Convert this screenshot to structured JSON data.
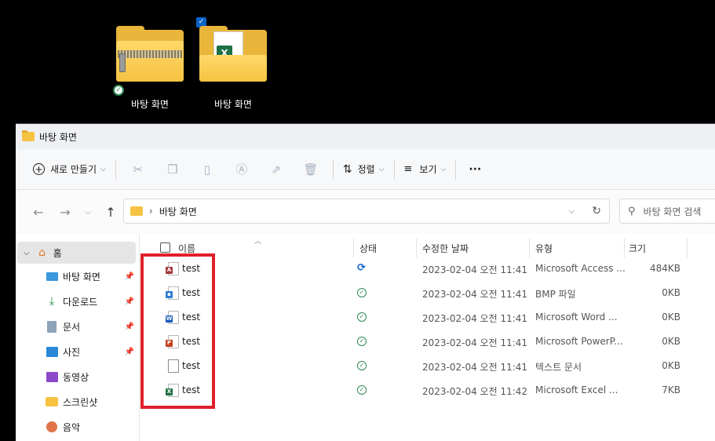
{
  "desktop": {
    "icons": [
      {
        "label": "바탕 화면",
        "type": "zip-folder",
        "status": "synced"
      },
      {
        "label": "바탕 화면",
        "type": "excel-folder",
        "selected": true
      }
    ]
  },
  "window": {
    "title": "바탕 화면",
    "toolbar": {
      "new_label": "새로 만들기",
      "sort_label": "정렬",
      "view_label": "보기",
      "more_label": "···",
      "icons": [
        "cut-icon",
        "copy-icon",
        "paste-icon",
        "rename-icon",
        "share-icon",
        "delete-icon"
      ]
    },
    "address": {
      "path_sep": "›",
      "path": "바탕 화면",
      "search_placeholder": "바탕 화면 검색"
    },
    "sidebar": {
      "home_label": "홈",
      "items": [
        {
          "label": "바탕 화면",
          "icon": "desktop-icon",
          "pinned": true
        },
        {
          "label": "다운로드",
          "icon": "download-icon",
          "pinned": true
        },
        {
          "label": "문서",
          "icon": "document-icon",
          "pinned": true
        },
        {
          "label": "사진",
          "icon": "pictures-icon",
          "pinned": true
        },
        {
          "label": "동영상",
          "icon": "videos-icon",
          "pinned": false
        },
        {
          "label": "스크린샷",
          "icon": "folder-icon",
          "pinned": false
        },
        {
          "label": "음악",
          "icon": "music-icon",
          "pinned": false
        }
      ]
    },
    "columns": {
      "name": "이름",
      "status": "상태",
      "modified": "수정한 날짜",
      "type": "유형",
      "size": "크기"
    },
    "files": [
      {
        "name": "test",
        "icon": "access-file-icon",
        "badge": "A",
        "color": "#a4373a",
        "status": "syncing",
        "modified": "2023-02-04 오전 11:41",
        "type": "Microsoft Access ...",
        "size": "484KB"
      },
      {
        "name": "test",
        "icon": "bmp-file-icon",
        "badge": "▪",
        "color": "#2b7cd3",
        "status": "ok",
        "modified": "2023-02-04 오전 11:41",
        "type": "BMP 파일",
        "size": "0KB"
      },
      {
        "name": "test",
        "icon": "word-file-icon",
        "badge": "W",
        "color": "#185abd",
        "status": "ok",
        "modified": "2023-02-04 오전 11:41",
        "type": "Microsoft Word ...",
        "size": "0KB"
      },
      {
        "name": "test",
        "icon": "powerpoint-file-icon",
        "badge": "P",
        "color": "#c43e1c",
        "status": "ok",
        "modified": "2023-02-04 오전 11:41",
        "type": "Microsoft PowerP...",
        "size": "0KB"
      },
      {
        "name": "test",
        "icon": "text-file-icon",
        "badge": "",
        "color": "#8a8a8a",
        "status": "ok",
        "modified": "2023-02-04 오전 11:41",
        "type": "텍스트 문서",
        "size": "0KB"
      },
      {
        "name": "test",
        "icon": "excel-file-icon",
        "badge": "X",
        "color": "#1e7145",
        "status": "ok",
        "modified": "2023-02-04 오전 11:42",
        "type": "Microsoft Excel ...",
        "size": "7KB"
      }
    ]
  }
}
